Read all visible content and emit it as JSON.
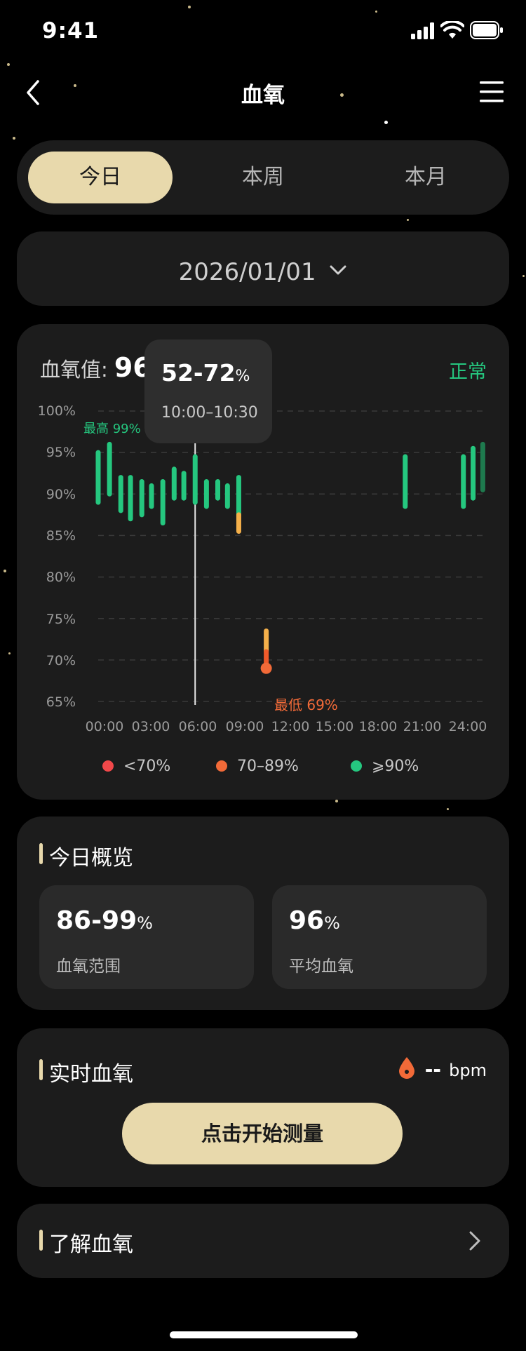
{
  "status_bar": {
    "time": "9:41"
  },
  "nav": {
    "title": "血氧"
  },
  "tabs": [
    {
      "label": "今日",
      "active": true
    },
    {
      "label": "本周",
      "active": false
    },
    {
      "label": "本月",
      "active": false
    }
  ],
  "date_selector": {
    "date": "2026/01/01"
  },
  "chart_card": {
    "value_label": "血氧值:",
    "value": "96",
    "status": "正常",
    "tooltip": {
      "range": "52-72",
      "unit": "%",
      "time": "10:00–10:30"
    },
    "max_label": "最高 99%",
    "min_label": "最低 69%"
  },
  "chart_data": {
    "type": "bar",
    "title": "",
    "ylim": [
      65,
      100
    ],
    "y_ticks": [
      "100%",
      "95%",
      "90%",
      "85%",
      "80%",
      "75%",
      "70%",
      "65%"
    ],
    "x_ticks": [
      "00:00",
      "03:00",
      "06:00",
      "09:00",
      "12:00",
      "15:00",
      "18:00",
      "21:00",
      "24:00"
    ],
    "grid": true,
    "ranges": [
      {
        "x": 0.0,
        "low": 89,
        "high": 95,
        "cat": "green"
      },
      {
        "x": 0.7,
        "low": 90,
        "high": 96,
        "cat": "green"
      },
      {
        "x": 1.4,
        "low": 88,
        "high": 92,
        "cat": "green"
      },
      {
        "x": 2.0,
        "low": 87,
        "high": 92,
        "cat": "green"
      },
      {
        "x": 2.7,
        "low": 87.5,
        "high": 91.5,
        "cat": "green"
      },
      {
        "x": 3.3,
        "low": 88.5,
        "high": 91,
        "cat": "green"
      },
      {
        "x": 4.0,
        "low": 86.5,
        "high": 91.5,
        "cat": "green"
      },
      {
        "x": 4.7,
        "low": 89.5,
        "high": 93,
        "cat": "green"
      },
      {
        "x": 5.3,
        "low": 89.5,
        "high": 92.5,
        "cat": "green"
      },
      {
        "x": 6.0,
        "low": 89,
        "high": 94.5,
        "cat": "green"
      },
      {
        "x": 6.7,
        "low": 88.5,
        "high": 91.5,
        "cat": "green"
      },
      {
        "x": 7.4,
        "low": 89.5,
        "high": 91.5,
        "cat": "green"
      },
      {
        "x": 8.0,
        "low": 88.5,
        "high": 91,
        "cat": "green"
      },
      {
        "x": 8.7,
        "low": 87.5,
        "high": 92,
        "cat": "green"
      },
      {
        "x": 8.7,
        "low": 85.5,
        "high": 87.5,
        "cat": "orange"
      },
      {
        "x": 10.4,
        "low": 71,
        "high": 73.5,
        "cat": "orange"
      },
      {
        "x": 10.4,
        "low": 69,
        "high": 71,
        "cat": "red"
      },
      {
        "x": 19.0,
        "low": 88.5,
        "high": 94.5,
        "cat": "green"
      },
      {
        "x": 22.6,
        "low": 88.5,
        "high": 94.5,
        "cat": "green"
      },
      {
        "x": 23.2,
        "low": 89.5,
        "high": 95.5,
        "cat": "green"
      },
      {
        "x": 23.8,
        "low": 90.5,
        "high": 96,
        "cat": "dim"
      }
    ],
    "selected_x": 6.0,
    "max_marker": {
      "x": 0.7,
      "y": 99
    },
    "min_marker": {
      "x": 10.4,
      "y": 69
    },
    "legend": [
      {
        "label": "<70%",
        "color": "#f2484a"
      },
      {
        "label": "70–89%",
        "color": "#f26a38"
      },
      {
        "label": "⩾90%",
        "color": "#25c77f"
      }
    ],
    "colors": {
      "green": "#25c77f",
      "orange": "#f5b04a",
      "red": "#f05a2a",
      "dim": "#1e7a4e"
    }
  },
  "overview": {
    "title": "今日概览",
    "range": {
      "value": "86-99",
      "unit": "%",
      "label": "血氧范围"
    },
    "avg": {
      "value": "96",
      "unit": "%",
      "label": "平均血氧"
    }
  },
  "realtime": {
    "title": "实时血氧",
    "hr_value": "--",
    "hr_unit": "bpm",
    "button_label": "点击开始测量"
  },
  "learn": {
    "title": "了解血氧"
  }
}
